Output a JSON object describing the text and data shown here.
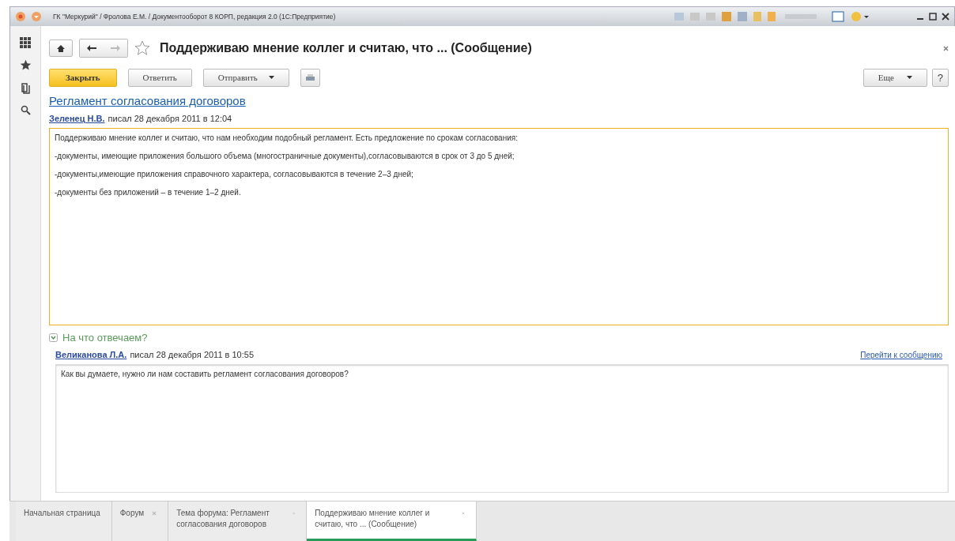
{
  "window": {
    "title": "ГК \"Меркурий\" / Фролова Е.М. / Документооборот 8 КОРП, редакция 2.0  (1С:Предприятие)"
  },
  "form": {
    "title": "Поддерживаю мнение коллег и считаю, что ... (Сообщение)",
    "favorite": false
  },
  "toolbar": {
    "buttons": [
      {
        "label": "Закрыть",
        "kind": "primary"
      },
      {
        "label": "Ответить",
        "kind": "plain"
      },
      {
        "label": "Отправить",
        "kind": "dropdown"
      }
    ],
    "more": "Еще",
    "help": "?"
  },
  "topic_link": "Регламент согласования договоров",
  "message": {
    "author": "Зеленец Н.В.",
    "meta": "писал 28 декабря 2011 в 12:04",
    "lines": [
      "Поддерживаю мнение коллег и считаю, что нам необходим подобный регламент. Есть предложение по срокам согласования:",
      "-документы, имеющие приложения большого объема (многостраничные документы),согласовываются в срок от 3 до 5 дней;",
      "-документы,имеющие приложения справочного характера, согласовываются в течение 2–3 дней;",
      "-документы без приложений – в течение 1–2 дней."
    ]
  },
  "reply_section": {
    "title": "На что отвечаем?",
    "expanded": true,
    "author": "Великанова Л.А.",
    "meta": "писал 28 декабря 2011 в 10:55",
    "goto_link": "Перейти к сообщению",
    "text": "Как вы думаете, нужно ли нам составить регламент согласования договоров?"
  },
  "open_tabs": [
    {
      "label": "Начальная страница",
      "closable": false,
      "selected": false
    },
    {
      "label": "Форум",
      "closable": true,
      "selected": false
    },
    {
      "label": "Тема форума: Регламент согласования договоров",
      "closable": true,
      "selected": false
    },
    {
      "label": "Поддерживаю мнение коллег и считаю, что ... (Сообщение)",
      "closable": true,
      "selected": true
    }
  ]
}
